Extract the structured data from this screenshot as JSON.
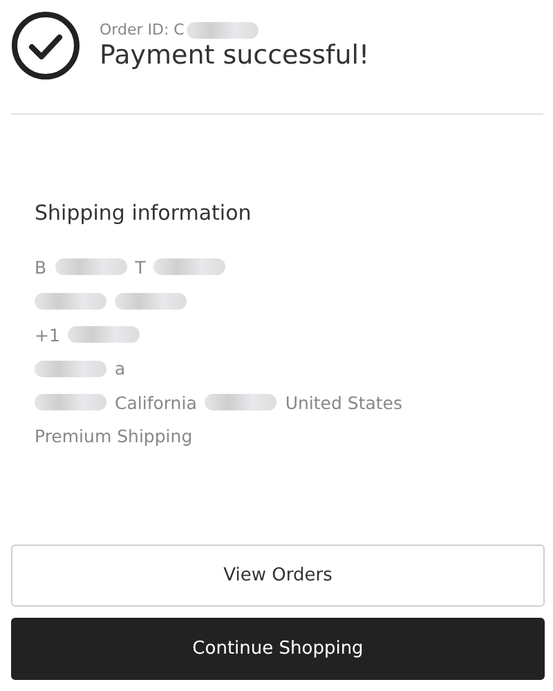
{
  "header": {
    "order_id_parts": [
      {
        "kind": "text",
        "text": "Order ID: C"
      },
      {
        "kind": "blur"
      }
    ],
    "title": "Payment successful!"
  },
  "shipping": {
    "heading": "Shipping information",
    "lines": [
      [
        {
          "kind": "text",
          "text": "B"
        },
        {
          "kind": "blur"
        },
        {
          "kind": "text",
          "text": "T"
        },
        {
          "kind": "blur"
        }
      ],
      [
        {
          "kind": "blur"
        },
        {
          "kind": "blur"
        }
      ],
      [
        {
          "kind": "text",
          "text": "+1"
        },
        {
          "kind": "blur"
        }
      ],
      [
        {
          "kind": "blur"
        },
        {
          "kind": "text",
          "text": "a"
        }
      ],
      [
        {
          "kind": "blur"
        },
        {
          "kind": "text",
          "text": "California"
        },
        {
          "kind": "blur"
        },
        {
          "kind": "text",
          "text": "United States"
        }
      ],
      [
        {
          "kind": "text",
          "text": "Premium Shipping"
        }
      ]
    ]
  },
  "buttons": [
    {
      "label": "View Orders",
      "kind": "secondary"
    },
    {
      "label": "Continue Shopping",
      "kind": "primary"
    }
  ]
}
